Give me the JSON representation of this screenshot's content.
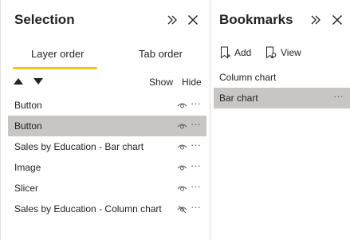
{
  "selection": {
    "title": "Selection",
    "tabs": [
      {
        "label": "Layer order",
        "active": true
      },
      {
        "label": "Tab order",
        "active": false
      }
    ],
    "show_label": "Show",
    "hide_label": "Hide",
    "layers": [
      {
        "label": "Button",
        "selected": false,
        "visible": true
      },
      {
        "label": "Button",
        "selected": true,
        "visible": true
      },
      {
        "label": "Sales by Education - Bar chart",
        "selected": false,
        "visible": true
      },
      {
        "label": "Image",
        "selected": false,
        "visible": true
      },
      {
        "label": "Slicer",
        "selected": false,
        "visible": true
      },
      {
        "label": "Sales by Education - Column chart",
        "selected": false,
        "visible": false
      }
    ],
    "more_label": "···"
  },
  "bookmarks": {
    "title": "Bookmarks",
    "add_label": "Add",
    "view_label": "View",
    "items": [
      {
        "label": "Column chart",
        "selected": false
      },
      {
        "label": "Bar chart",
        "selected": true
      }
    ],
    "more_label": "···"
  },
  "colors": {
    "accent_underline": "#f2c811",
    "selected_row": "#c8c6c4",
    "border": "#e1dfdd"
  },
  "icons": {
    "collapse": "double-chevron-right-icon",
    "close": "close-icon",
    "move_up": "triangle-up-icon",
    "move_down": "triangle-down-icon",
    "visible": "eye-icon",
    "hidden": "eye-slash-icon",
    "add": "bookmark-add-icon",
    "view": "bookmark-view-icon"
  }
}
